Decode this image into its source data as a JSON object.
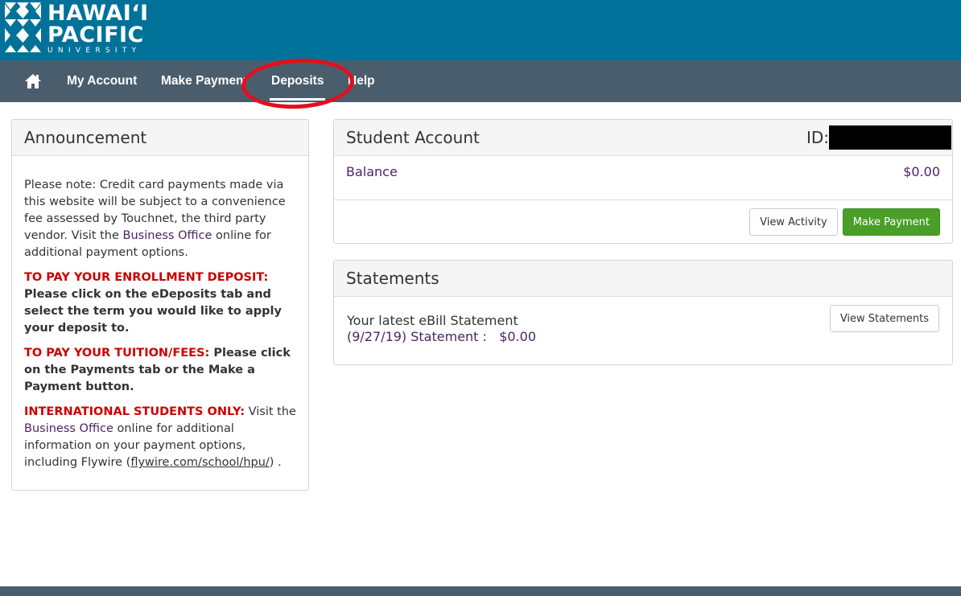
{
  "brand": {
    "line1": "HAWAI‘I",
    "line2": "PACIFIC",
    "line3": "UNIVERSITY",
    "header_color": "#007299",
    "nav_color": "#4a5d6d"
  },
  "nav": {
    "home_icon": "home-icon",
    "items": [
      {
        "label": "My Account"
      },
      {
        "label": "Make Payment"
      },
      {
        "label": "Deposits"
      },
      {
        "label": "Help"
      }
    ],
    "highlight_color": "#e30f1c"
  },
  "announcement": {
    "title": "Announcement",
    "p1_text1": "Please note: Credit card payments made via this website will be subject to a convenience fee assessed by Touchnet, the third party vendor. Visit the ",
    "p1_link": "Business Office",
    "p1_text2": " online for additional payment options.",
    "p2_red": "TO PAY YOUR ENROLLMENT DEPOSIT:",
    "p2_bold": "Please click on the eDeposits tab and select the term you would like to apply your deposit to.",
    "p3_red": "TO PAY YOUR TUITION/FEES:",
    "p3_bold": " Please click on the Payments tab or the Make a Payment button.",
    "p4_red": "INTERNATIONAL STUDENTS ONLY:",
    "p4_text1": " Visit the ",
    "p4_link": "Business Office",
    "p4_text2": " online for additional information on your payment options, including Flywire (",
    "p4_url": "flywire.com/school/hpu/",
    "p4_text3": ") ."
  },
  "student_account": {
    "title": "Student Account",
    "id_label": "ID:",
    "balance_label": "Balance",
    "balance_value": "$0.00",
    "view_activity": "View Activity",
    "make_payment": "Make Payment"
  },
  "statements": {
    "title": "Statements",
    "latest_label": "Your latest eBill Statement",
    "statement_line": "(9/27/19) Statement :",
    "statement_amount": "$0.00",
    "view_statements": "View Statements"
  }
}
